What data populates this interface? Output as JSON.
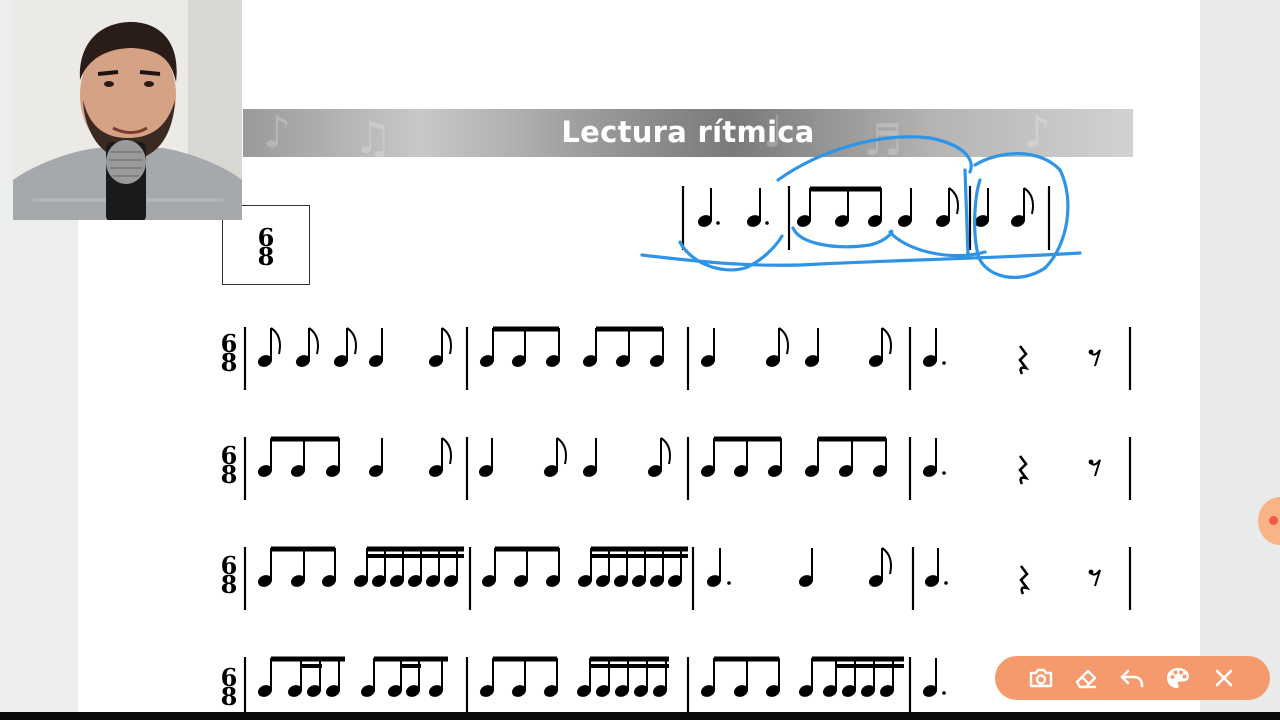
{
  "banner": {
    "title": "Lectura rítmica"
  },
  "time_signature": {
    "numerator": "6",
    "denominator": "8"
  },
  "staff_rows": [
    {
      "id": "row-1"
    },
    {
      "id": "row-2"
    },
    {
      "id": "row-3"
    },
    {
      "id": "row-4"
    }
  ],
  "toolbar": {
    "items": [
      "camera-icon",
      "eraser-icon",
      "undo-icon",
      "palette-icon",
      "close-icon"
    ]
  },
  "colors": {
    "annotation": "#2f94e6",
    "toolbar": "#f59a6c",
    "banner_text": "#ffffff"
  }
}
